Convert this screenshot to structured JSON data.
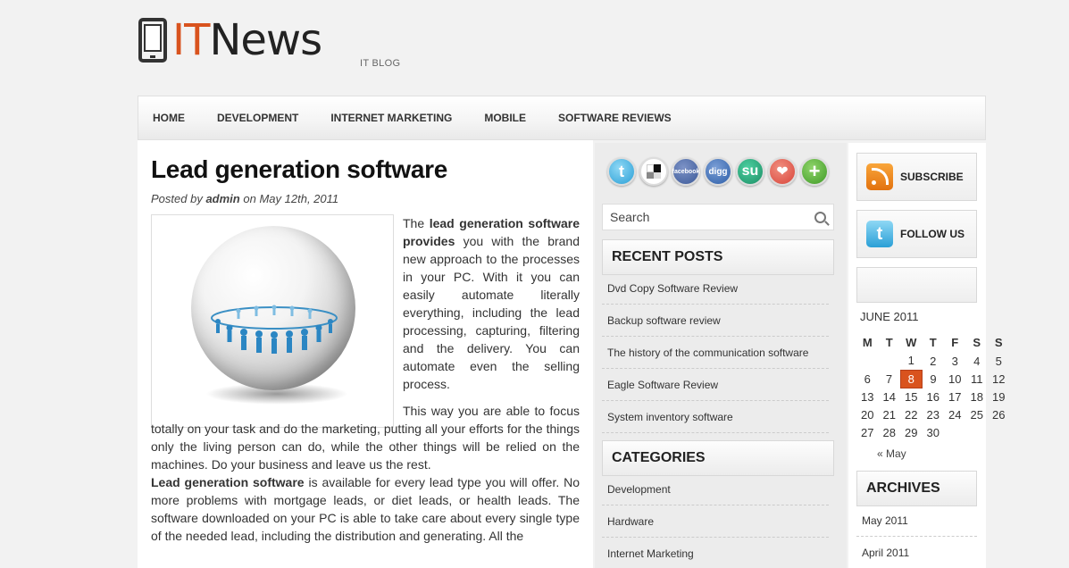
{
  "header": {
    "logo_it": "IT",
    "logo_news": "News",
    "tagline": "IT BLOG"
  },
  "nav": [
    "HOME",
    "DEVELOPMENT",
    "INTERNET MARKETING",
    "MOBILE",
    "SOFTWARE REVIEWS"
  ],
  "post": {
    "title": "Lead generation software",
    "meta_prefix": "Posted by",
    "author": "admin",
    "meta_on": "on",
    "date": "May 12th, 2011",
    "p1_a": "The",
    "p1_bold": "lead generation software provides",
    "p1_b": "you with the brand new approach to the processes in your PC. With it you can easily automate literally everything, including the lead processing, capturing, filtering and the delivery. You can automate even the selling process.",
    "p2": "This way you are able to focus totally on your task and do the marketing, putting all your efforts for the things only the living person can do, while the other things will be relied on the machines. Do your business and leave us the rest.",
    "p3_bold": "Lead generation software",
    "p3": "is available for every lead type you will offer. No more problems with mortgage leads, or diet leads, or health leads. The software downloaded on your PC is able to take care about every single type of the needed lead, including the distribution and generating. All the"
  },
  "social": {
    "twitter": "t",
    "facebook": "facebook",
    "digg": "digg",
    "stumble": "su",
    "heart": "❤",
    "plus": "+"
  },
  "search": {
    "placeholder": "Search"
  },
  "recent_posts": {
    "title": "RECENT POSTS",
    "items": [
      "Dvd Copy Software Review",
      "Backup software review",
      "The history of the communication software",
      "Eagle Software Review",
      "System inventory software"
    ]
  },
  "categories": {
    "title": "CATEGORIES",
    "items": [
      "Development",
      "Hardware",
      "Internet Marketing"
    ]
  },
  "right": {
    "subscribe": "SUBSCRIBE",
    "follow": "FOLLOW US",
    "twitter_glyph": "t"
  },
  "calendar": {
    "caption": "JUNE 2011",
    "days": [
      "M",
      "T",
      "W",
      "T",
      "F",
      "S",
      "S"
    ],
    "weeks": [
      [
        "",
        "",
        "1",
        "2",
        "3",
        "4",
        "5"
      ],
      [
        "6",
        "7",
        "8",
        "9",
        "10",
        "11",
        "12"
      ],
      [
        "13",
        "14",
        "15",
        "16",
        "17",
        "18",
        "19"
      ],
      [
        "20",
        "21",
        "22",
        "23",
        "24",
        "25",
        "26"
      ],
      [
        "27",
        "28",
        "29",
        "30",
        "",
        "",
        ""
      ]
    ],
    "today": "8",
    "prev": "« May"
  },
  "archives": {
    "title": "ARCHIVES",
    "items": [
      "May 2011",
      "April 2011"
    ]
  }
}
